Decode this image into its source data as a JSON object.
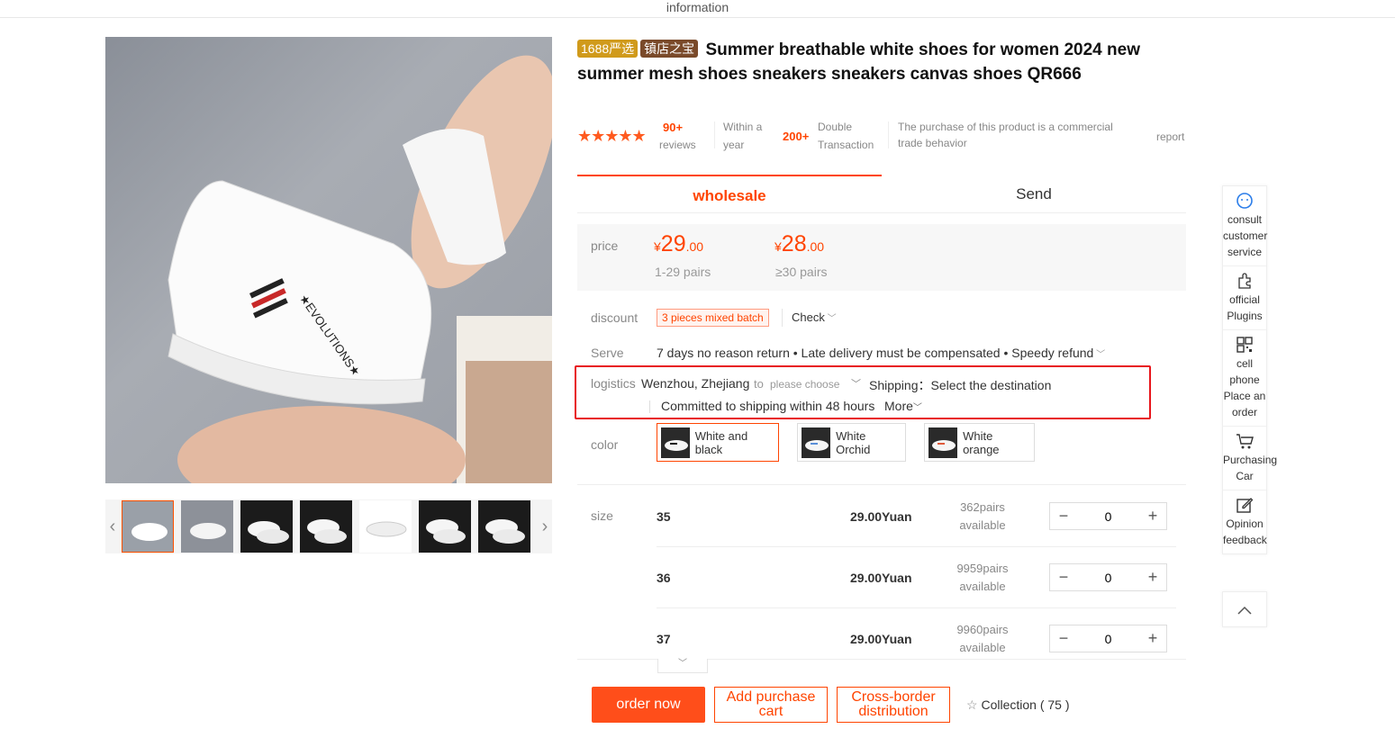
{
  "header": {
    "title": "information"
  },
  "product": {
    "badge1": "1688严选",
    "badge2": "镇店之宝",
    "title": "Summer breathable white shoes for women 2024 new summer mesh shoes sneakers sneakers canvas shoes QR666"
  },
  "stats": {
    "reviews_count": "90+",
    "reviews_label": "reviews",
    "period": "Within a year",
    "transactions_count": "200+",
    "transactions_label": "Double Transaction",
    "note": "The purchase of this product is a commercial trade behavior",
    "report": "report",
    "rating_stars": 5
  },
  "tabs": [
    {
      "label": "wholesale",
      "active": true
    },
    {
      "label": "Send",
      "active": false
    }
  ],
  "pricing": {
    "label": "price",
    "tiers": [
      {
        "currency": "¥",
        "int": "29",
        "dec": ".00",
        "range": "1-29 pairs"
      },
      {
        "currency": "¥",
        "int": "28",
        "dec": ".00",
        "range": "≥30 pairs"
      }
    ]
  },
  "discount": {
    "label": "discount",
    "tag": "3 pieces mixed batch",
    "check": "Check"
  },
  "serve": {
    "label": "Serve",
    "text": "7 days no reason return • Late delivery must be compensated • Speedy refund"
  },
  "logistics": {
    "label": "logistics",
    "origin": "Wenzhou, Zhejiang",
    "to": "to",
    "destination_placeholder": "please choose",
    "shipping": "Shipping：Select the destination",
    "commitment": "Committed to shipping within 48 hours",
    "more": "More"
  },
  "color": {
    "label": "color",
    "options": [
      {
        "name": "White and black",
        "selected": true,
        "accent": "#1a1a1a"
      },
      {
        "name": "White Orchid",
        "selected": false,
        "accent": "#5a8fd8"
      },
      {
        "name": "White orange",
        "selected": false,
        "accent": "#e05a3a"
      }
    ]
  },
  "size": {
    "label": "size",
    "rows": [
      {
        "size": "35",
        "price": "29.00Yuan",
        "stock": "362pairs",
        "available": "available",
        "qty": "0"
      },
      {
        "size": "36",
        "price": "29.00Yuan",
        "stock": "9959pairs",
        "available": "available",
        "qty": "0"
      },
      {
        "size": "37",
        "price": "29.00Yuan",
        "stock": "9960pairs",
        "available": "available",
        "qty": "0"
      }
    ]
  },
  "actions": {
    "order_now": "order now",
    "add_cart_1": "Add purchase",
    "add_cart_2": "cart",
    "cross_1": "Cross-border",
    "cross_2": "distribution",
    "collection": "Collection ( 75 )"
  },
  "sidebar": [
    {
      "icon": "customer-service-icon",
      "label": "consult customer service"
    },
    {
      "icon": "puzzle-icon",
      "label": "official Plugins"
    },
    {
      "icon": "qr-code-icon",
      "label": "cell phone Place an order"
    },
    {
      "icon": "cart-icon",
      "label": "Purchasing Car"
    },
    {
      "icon": "edit-icon",
      "label": "Opinion feedback"
    }
  ],
  "colors": {
    "accent": "#ff4400",
    "highlight_border": "#e8161c"
  }
}
